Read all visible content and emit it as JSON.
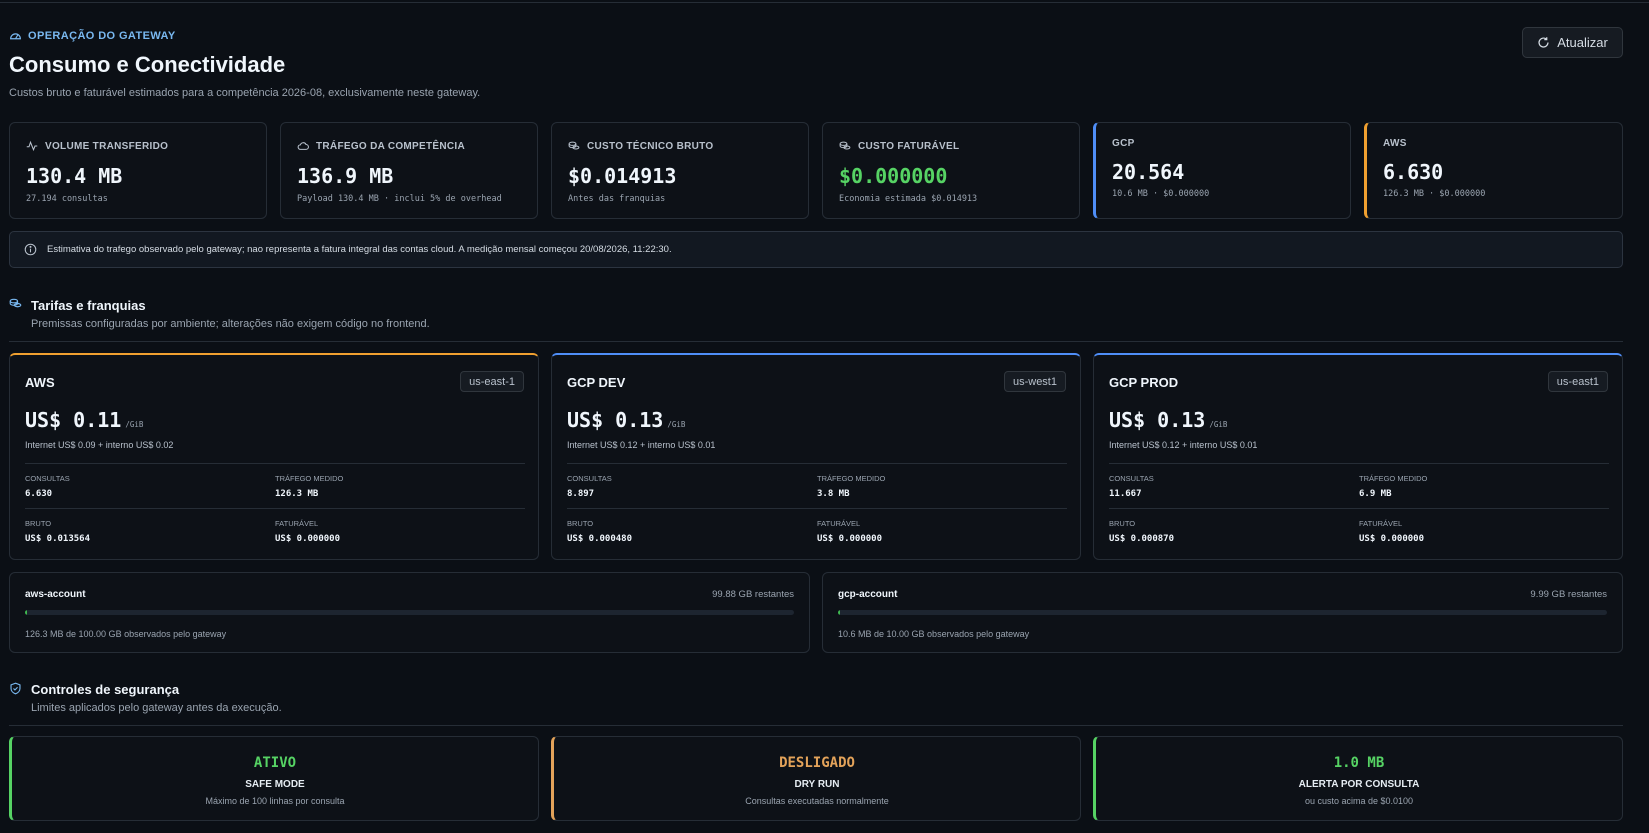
{
  "header": {
    "eyebrow": "OPERAÇÃO DO GATEWAY",
    "title": "Consumo e Conectividade",
    "subtitle": "Custos bruto e faturável estimados para a competência 2026-08, exclusivamente neste gateway.",
    "refresh_label": "Atualizar"
  },
  "stats": [
    {
      "label": "VOLUME TRANSFERIDO",
      "value": "130.4 MB",
      "note": "27.194 consultas",
      "icon": "activity-icon"
    },
    {
      "label": "TRÁFEGO DA COMPETÊNCIA",
      "value": "136.9 MB",
      "note": "Payload 130.4 MB · inclui 5% de overhead",
      "icon": "cloud-icon"
    },
    {
      "label": "CUSTO TÉCNICO BRUTO",
      "value": "$0.014913",
      "note": "Antes das franquias",
      "icon": "coins-icon"
    },
    {
      "label": "CUSTO FATURÁVEL",
      "value": "$0.000000",
      "note": "Economia estimada $0.014913",
      "icon": "coins-icon"
    }
  ],
  "clouds": [
    {
      "label": "GCP",
      "value": "20.564",
      "note": "10.6 MB · $0.000000",
      "color": "#4f8ef7"
    },
    {
      "label": "AWS",
      "value": "6.630",
      "note": "126.3 MB · $0.000000",
      "color": "#f0a030"
    }
  ],
  "info": "Estimativa do trafego observado pelo gateway; nao representa a fatura integral das contas cloud. A medição mensal começou 20/08/2026, 11:22:30.",
  "tariffs_section": {
    "title": "Tarifas e franquias",
    "subtitle": "Premissas configuradas por ambiente; alterações não exigem código no frontend."
  },
  "tariffs": [
    {
      "name": "AWS",
      "region": "us-east-1",
      "price": "US$ 0.11",
      "unit": "/GiB",
      "breakdown": "Internet US$ 0.09 + interno US$ 0.02",
      "consultas_label": "CONSULTAS",
      "consultas": "6.630",
      "trafego_label": "TRÁFEGO MEDIDO",
      "trafego": "126.3 MB",
      "bruto_label": "BRUTO",
      "bruto": "US$ 0.013564",
      "faturavel_label": "FATURÁVEL",
      "faturavel": "US$ 0.000000",
      "color": "#f0a030"
    },
    {
      "name": "GCP DEV",
      "region": "us-west1",
      "price": "US$ 0.13",
      "unit": "/GiB",
      "breakdown": "Internet US$ 0.12 + interno US$ 0.01",
      "consultas_label": "CONSULTAS",
      "consultas": "8.897",
      "trafego_label": "TRÁFEGO MEDIDO",
      "trafego": "3.8 MB",
      "bruto_label": "BRUTO",
      "bruto": "US$ 0.000480",
      "faturavel_label": "FATURÁVEL",
      "faturavel": "US$ 0.000000",
      "color": "#4f8ef7"
    },
    {
      "name": "GCP PROD",
      "region": "us-east1",
      "price": "US$ 0.13",
      "unit": "/GiB",
      "breakdown": "Internet US$ 0.12 + interno US$ 0.01",
      "consultas_label": "CONSULTAS",
      "consultas": "11.667",
      "trafego_label": "TRÁFEGO MEDIDO",
      "trafego": "6.9 MB",
      "bruto_label": "BRUTO",
      "bruto": "US$ 0.000870",
      "faturavel_label": "FATURÁVEL",
      "faturavel": "US$ 0.000000",
      "color": "#4f8ef7"
    }
  ],
  "quotas": [
    {
      "account": "aws-account",
      "remaining": "99.88 GB restantes",
      "observed": "126.3 MB de 100.00 GB observados pelo gateway",
      "fill_fraction": 0.0013
    },
    {
      "account": "gcp-account",
      "remaining": "9.99 GB restantes",
      "observed": "10.6 MB de 10.00 GB observados pelo gateway",
      "fill_fraction": 0.0011
    }
  ],
  "security_section": {
    "title": "Controles de segurança",
    "subtitle": "Limites aplicados pelo gateway antes da execução."
  },
  "security": [
    {
      "state": "ATIVO",
      "title": "SAFE MODE",
      "desc": "Máximo de 100 linhas por consulta",
      "color": "#56d364"
    },
    {
      "state": "DESLIGADO",
      "title": "DRY RUN",
      "desc": "Consultas executadas normalmente",
      "color": "#e3a35a"
    },
    {
      "state": "1.0 MB",
      "title": "ALERTA POR CONSULTA",
      "desc": "ou custo acima de $0.0100",
      "color": "#56d364"
    }
  ]
}
